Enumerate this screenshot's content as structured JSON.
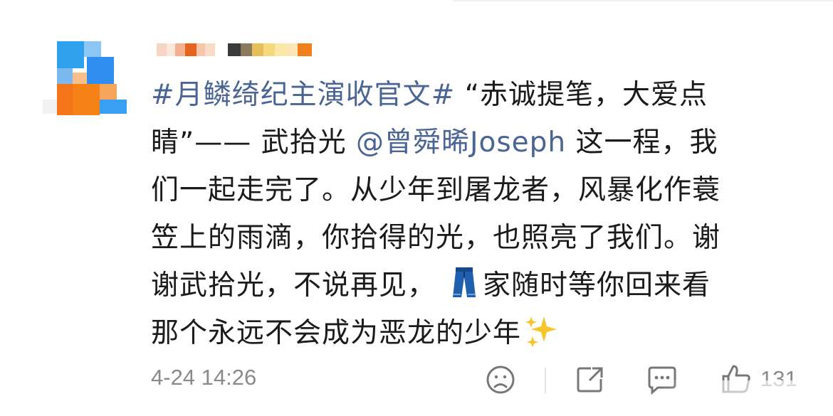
{
  "post": {
    "content": {
      "topic": "#月鳞绮纪主演收官文#",
      "line1_rest": " “赤诚提笔，大爱点",
      "line2_start": "睛”—— 武拾光 ",
      "mention": "@曾舜晞Joseph",
      "line2_rest": " 这一程，我",
      "line3": "们一起走完了。从少年到屠龙者，风暴化作蓑",
      "line4": "笠上的雨滴，你拾得的光，也照亮了我们。谢",
      "line5_start": "谢武拾光，不说再见，",
      "line5_rest": "家随时等你回来看",
      "line6": "那个永远不会成为恶龙的少年"
    },
    "footer": {
      "timestamp": "4-24 14:26",
      "like_count": "131"
    },
    "icons": [
      "avatar",
      "jeans-emoji",
      "sparkles-emoji",
      "dislike-face-icon",
      "share-icon",
      "comment-icon",
      "like-thumb-icon"
    ],
    "colors": {
      "link": "#4a6593",
      "text": "#1b1b1b",
      "meta": "#8a8a8a"
    }
  }
}
